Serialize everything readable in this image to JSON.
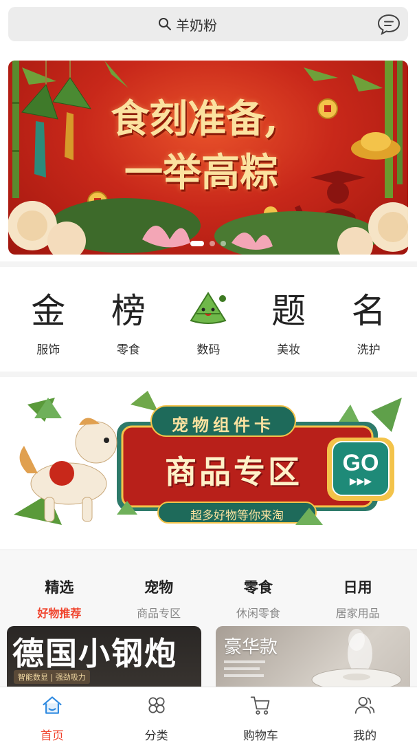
{
  "search": {
    "text": "羊奶粉"
  },
  "banner": {
    "line1": "食刻准备,",
    "line2": "一举高粽"
  },
  "categories": [
    {
      "glyph": "金",
      "label": "服饰"
    },
    {
      "glyph": "榜",
      "label": "零食"
    },
    {
      "glyph": "",
      "label": "数码"
    },
    {
      "glyph": "题",
      "label": "美妆"
    },
    {
      "glyph": "名",
      "label": "洗护"
    }
  ],
  "promo": {
    "top": "宠物组件卡",
    "title": "商品专区",
    "subtitle": "超多好物等你来淘",
    "go": "GO"
  },
  "tabs": [
    {
      "title": "精选",
      "sub": "好物推荐"
    },
    {
      "title": "宠物",
      "sub": "商品专区"
    },
    {
      "title": "零食",
      "sub": "休闲零食"
    },
    {
      "title": "日用",
      "sub": "居家用品"
    }
  ],
  "cards": {
    "card1": {
      "title": "德国小钢炮",
      "tag": "智能数显 | 强劲吸力"
    },
    "card2": {
      "title": "豪华款"
    }
  },
  "nav": [
    {
      "label": "首页",
      "icon": "home-icon"
    },
    {
      "label": "分类",
      "icon": "category-icon"
    },
    {
      "label": "购物车",
      "icon": "cart-icon"
    },
    {
      "label": "我的",
      "icon": "user-icon"
    }
  ],
  "colors": {
    "accent": "#f0432c",
    "banner": "#c8281a",
    "promo": "#b8201a"
  }
}
